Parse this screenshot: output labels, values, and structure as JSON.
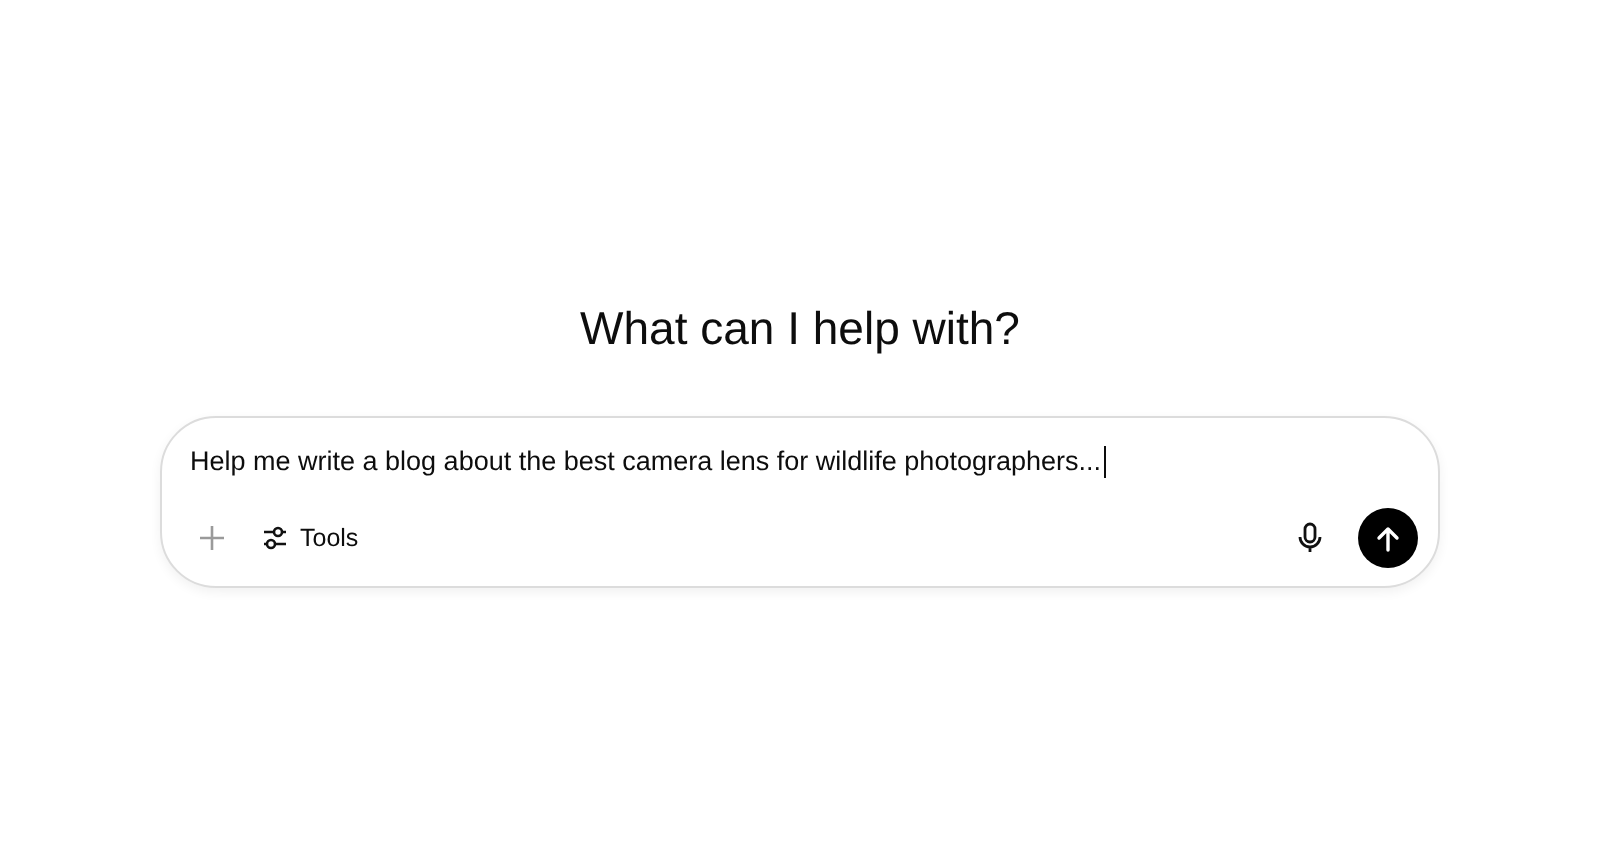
{
  "heading": "What can I help with?",
  "composer": {
    "value": "Help me write a blog about the best camera lens for wildlife photographers...",
    "tools_label": "Tools"
  }
}
